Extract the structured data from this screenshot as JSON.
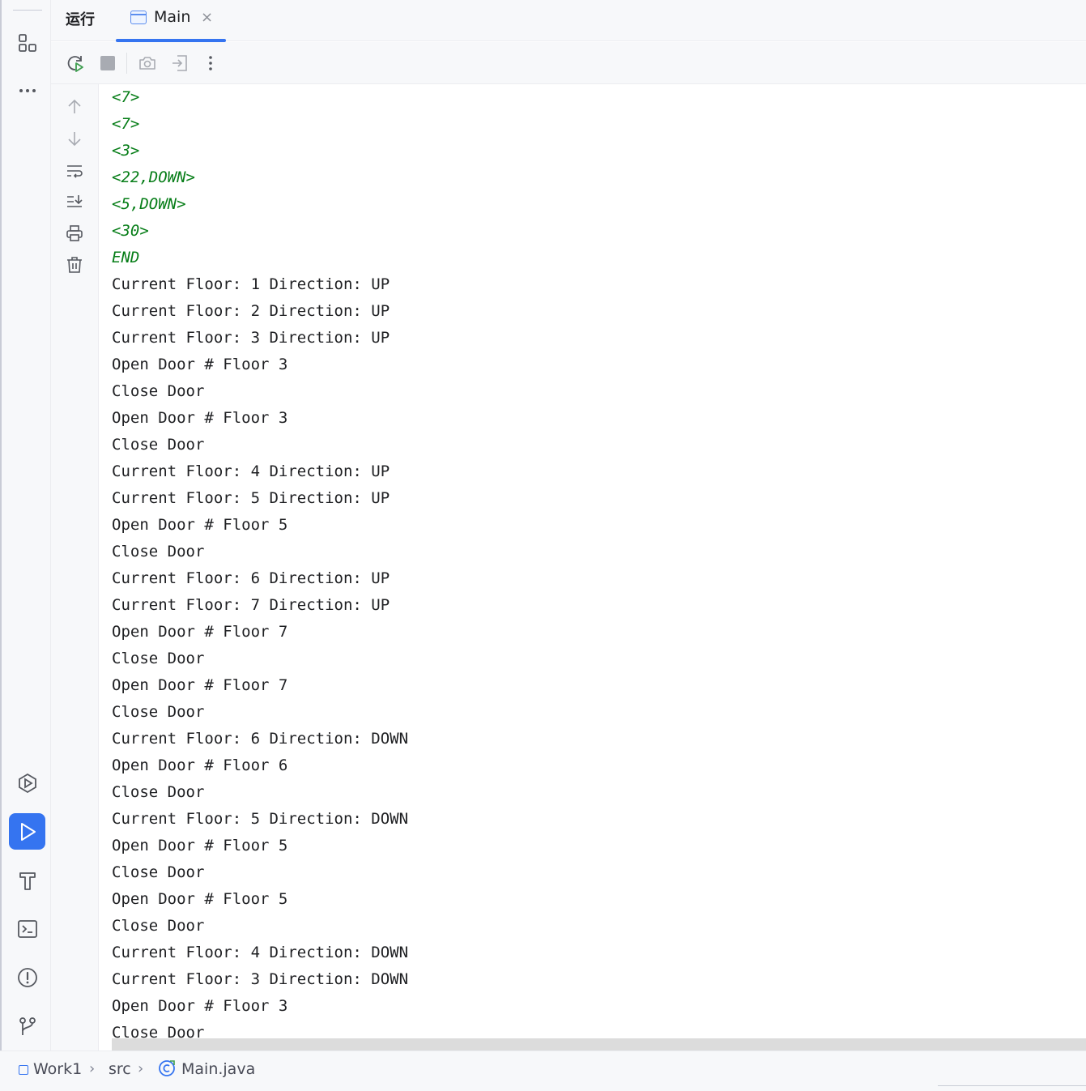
{
  "tool_window": {
    "title": "运行",
    "tab": {
      "label": "Main",
      "close": "×"
    }
  },
  "console": {
    "lines": [
      {
        "text": "<7>",
        "kind": "input"
      },
      {
        "text": "<7>",
        "kind": "input"
      },
      {
        "text": "<3>",
        "kind": "input"
      },
      {
        "text": "<22,DOWN>",
        "kind": "input"
      },
      {
        "text": "<5,DOWN>",
        "kind": "input"
      },
      {
        "text": "<30>",
        "kind": "input"
      },
      {
        "text": "END",
        "kind": "input"
      },
      {
        "text": "Current Floor: 1 Direction: UP",
        "kind": "output"
      },
      {
        "text": "Current Floor: 2 Direction: UP",
        "kind": "output"
      },
      {
        "text": "Current Floor: 3 Direction: UP",
        "kind": "output"
      },
      {
        "text": "Open Door # Floor 3",
        "kind": "output"
      },
      {
        "text": "Close Door",
        "kind": "output"
      },
      {
        "text": "Open Door # Floor 3",
        "kind": "output"
      },
      {
        "text": "Close Door",
        "kind": "output"
      },
      {
        "text": "Current Floor: 4 Direction: UP",
        "kind": "output"
      },
      {
        "text": "Current Floor: 5 Direction: UP",
        "kind": "output"
      },
      {
        "text": "Open Door # Floor 5",
        "kind": "output"
      },
      {
        "text": "Close Door",
        "kind": "output"
      },
      {
        "text": "Current Floor: 6 Direction: UP",
        "kind": "output"
      },
      {
        "text": "Current Floor: 7 Direction: UP",
        "kind": "output"
      },
      {
        "text": "Open Door # Floor 7",
        "kind": "output"
      },
      {
        "text": "Close Door",
        "kind": "output"
      },
      {
        "text": "Open Door # Floor 7",
        "kind": "output"
      },
      {
        "text": "Close Door",
        "kind": "output"
      },
      {
        "text": "Current Floor: 6 Direction: DOWN",
        "kind": "output"
      },
      {
        "text": "Open Door # Floor 6",
        "kind": "output"
      },
      {
        "text": "Close Door",
        "kind": "output"
      },
      {
        "text": "Current Floor: 5 Direction: DOWN",
        "kind": "output"
      },
      {
        "text": "Open Door # Floor 5",
        "kind": "output"
      },
      {
        "text": "Close Door",
        "kind": "output"
      },
      {
        "text": "Open Door # Floor 5",
        "kind": "output"
      },
      {
        "text": "Close Door",
        "kind": "output"
      },
      {
        "text": "Current Floor: 4 Direction: DOWN",
        "kind": "output"
      },
      {
        "text": "Current Floor: 3 Direction: DOWN",
        "kind": "output"
      },
      {
        "text": "Open Door # Floor 3",
        "kind": "output"
      },
      {
        "text": "Close Door",
        "kind": "output"
      }
    ]
  },
  "breadcrumb": {
    "project": "Work1",
    "folder": "src",
    "file": "Main.java"
  },
  "icons": {
    "left_strip": [
      "structure-icon",
      "more-icon",
      "services-icon",
      "run-icon",
      "build-icon",
      "terminal-icon",
      "problems-icon",
      "git-icon"
    ],
    "toolbar": [
      "rerun-icon",
      "stop-icon",
      "screenshot-icon",
      "restore-layout-icon",
      "more-vertical-icon"
    ],
    "gutter": [
      "up-arrow-icon",
      "down-arrow-icon",
      "soft-wrap-icon",
      "scroll-to-end-icon",
      "print-icon",
      "trash-icon"
    ]
  },
  "colors": {
    "accent": "#3574f0",
    "input_text": "#067d17",
    "output_text": "#1e1f22",
    "panel_bg": "#f7f8fa"
  }
}
